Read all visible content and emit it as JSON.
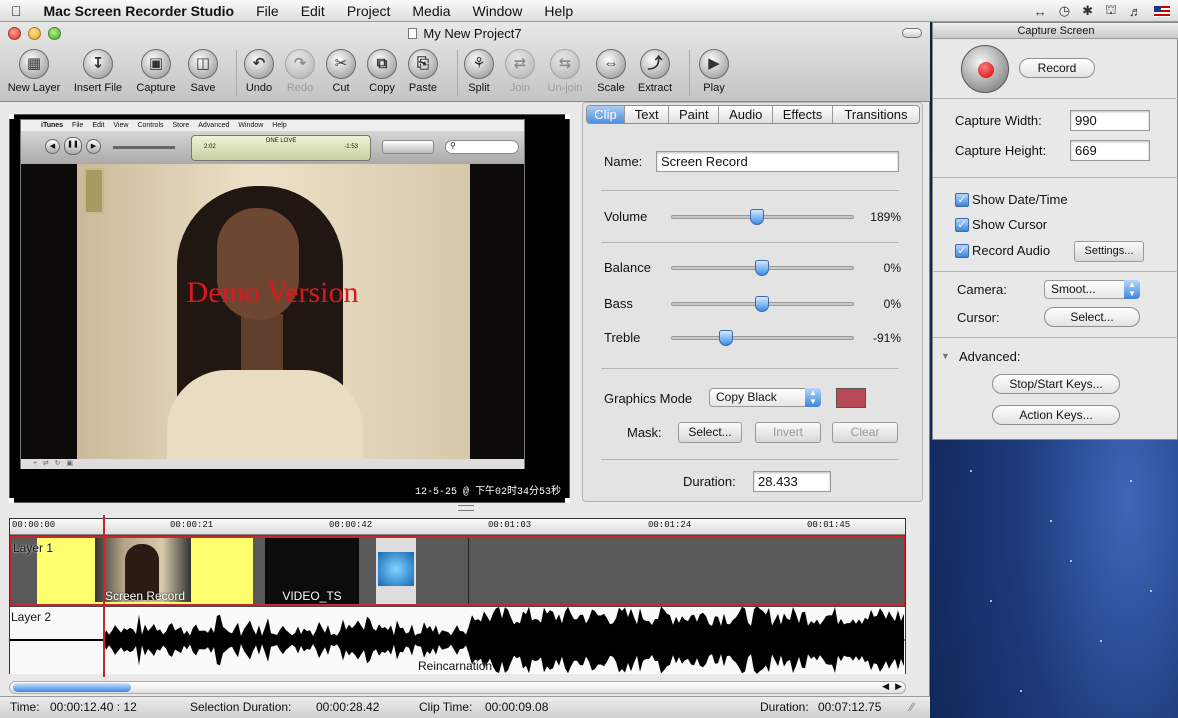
{
  "menubar": {
    "apple_icon": "apple-icon",
    "app": "Mac Screen Recorder Studio",
    "items": [
      "File",
      "Edit",
      "Project",
      "Media",
      "Window",
      "Help"
    ],
    "status_icons": [
      "flag-icon",
      "volume-icon",
      "wifi-icon",
      "bluetooth-icon",
      "time-machine-icon",
      "sync-icon"
    ]
  },
  "window": {
    "title": "My New Project7"
  },
  "toolbar": [
    {
      "label": "New Layer",
      "icon": "new-layer-icon",
      "enabled": true
    },
    {
      "label": "Insert File",
      "icon": "insert-file-icon",
      "enabled": true
    },
    {
      "label": "Capture",
      "icon": "capture-icon",
      "enabled": true
    },
    {
      "label": "Save",
      "icon": "save-icon",
      "enabled": true
    },
    {
      "label": "Undo",
      "icon": "undo-icon",
      "enabled": true
    },
    {
      "label": "Redo",
      "icon": "redo-icon",
      "enabled": false
    },
    {
      "label": "Cut",
      "icon": "cut-icon",
      "enabled": true
    },
    {
      "label": "Copy",
      "icon": "copy-icon",
      "enabled": true
    },
    {
      "label": "Paste",
      "icon": "paste-icon",
      "enabled": true
    },
    {
      "label": "Split",
      "icon": "split-icon",
      "enabled": true
    },
    {
      "label": "Join",
      "icon": "join-icon",
      "enabled": false
    },
    {
      "label": "Un-join",
      "icon": "unjoin-icon",
      "enabled": false
    },
    {
      "label": "Scale",
      "icon": "scale-icon",
      "enabled": true
    },
    {
      "label": "Extract",
      "icon": "extract-icon",
      "enabled": true
    },
    {
      "label": "Play",
      "icon": "play-icon",
      "enabled": true
    }
  ],
  "preview": {
    "itunes_menu": [
      "iTunes",
      "File",
      "Edit",
      "View",
      "Controls",
      "Store",
      "Advanced",
      "Window",
      "Help"
    ],
    "lcd_song": "ONE LOVE",
    "lcd_elapsed": "2:02",
    "lcd_remaining": "-1:53",
    "watermark": "Demo Version",
    "timestamp": "12-5-25 @ 下午02时34分53秒"
  },
  "inspector": {
    "tabs": [
      "Clip",
      "Text",
      "Paint",
      "Audio",
      "Effects",
      "Transitions"
    ],
    "selected_tab": "Clip",
    "name_label": "Name:",
    "name_value": "Screen Record",
    "sliders": [
      {
        "label": "Volume",
        "value": "189%",
        "level": 0.48
      },
      {
        "label": "Balance",
        "value": "0%",
        "level": 0.5
      },
      {
        "label": "Bass",
        "value": "0%",
        "level": 0.5
      },
      {
        "label": "Treble",
        "value": "-91%",
        "level": 0.3
      }
    ],
    "graphics_mode_label": "Graphics Mode",
    "graphics_mode_value": "Copy Black",
    "graphics_color": "#b64b55",
    "mask_label": "Mask:",
    "mask_buttons": [
      "Select...",
      "Invert",
      "Clear"
    ],
    "duration_label": "Duration:",
    "duration_value": "28.433"
  },
  "timeline": {
    "ticks": [
      "00:00:00",
      "00:00:21",
      "00:00:42",
      "00:01:03",
      "00:01:24",
      "00:01:45"
    ],
    "layer1": {
      "label": "Layer 1",
      "clips": [
        {
          "title": "Screen Record"
        },
        {
          "title": "VIDEO_TS"
        },
        {
          "title": ""
        }
      ]
    },
    "layer2": {
      "label": "Layer 2",
      "clip": "Reincarnation"
    }
  },
  "status": {
    "time_label": "Time:",
    "time_value": "00:00:12.40 : 12",
    "sel_label": "Selection Duration:",
    "sel_value": "00:00:28.42",
    "clip_label": "Clip Time:",
    "clip_value": "00:00:09.08",
    "dur_label": "Duration:",
    "dur_value": "00:07:12.75"
  },
  "capture": {
    "title": "Capture Screen",
    "record": "Record",
    "width_label": "Capture Width:",
    "width_value": "990",
    "height_label": "Capture Height:",
    "height_value": "669",
    "show_datetime": "Show Date/Time",
    "show_cursor": "Show Cursor",
    "record_audio": "Record Audio",
    "settings": "Settings...",
    "camera_label": "Camera:",
    "camera_value": "Smoot...",
    "cursor_label": "Cursor:",
    "cursor_button": "Select...",
    "advanced": "Advanced:",
    "stop_start_keys": "Stop/Start Keys...",
    "action_keys": "Action Keys..."
  },
  "colors": {
    "accent": "#3d86db",
    "record_red": "#d00000",
    "track_border": "#c8262a",
    "clip_yellow": "#fdfd6e"
  }
}
